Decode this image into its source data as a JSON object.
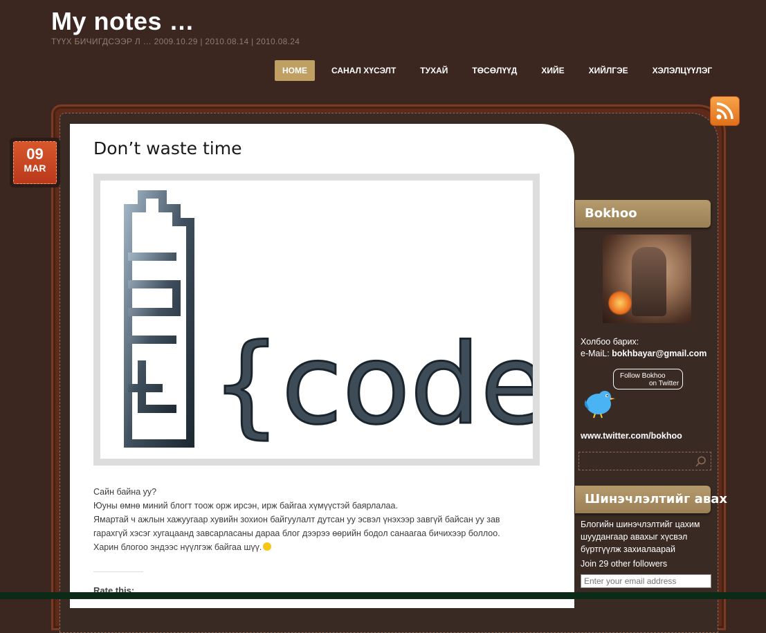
{
  "site": {
    "title": "My notes …",
    "description": "ТҮҮХ БИЧИГДСЭЭР Л … 2009.10.29 | 2010.08.14 | 2010.08.24"
  },
  "nav": {
    "items": [
      {
        "label": "HOME",
        "active": true
      },
      {
        "label": "САНАЛ ХҮСЭЛТ",
        "active": false
      },
      {
        "label": "ТУХАЙ",
        "active": false
      },
      {
        "label": "ТӨСӨЛҮҮД",
        "active": false
      },
      {
        "label": "ХИЙЕ",
        "active": false
      },
      {
        "label": "ХИЙЛГЭЕ",
        "active": false
      },
      {
        "label": "ХЭЛЭЛЦҮҮЛЭГ",
        "active": false
      }
    ]
  },
  "post": {
    "date_day": "09",
    "date_month": "MAR",
    "title": "Don’t waste time",
    "image_text": "{coder}",
    "body": [
      "Сайн байна уу?",
      "Юуны өмнө миний блогт тоож орж ирсэн, ирж байгаа хүмүүстэй баярлалаа.",
      "Ямартай ч ажлын хажуугаар хувийн зохион байгуулалт дутсан уу эсвэл үнэхээр завгүй байсан уу зав гарахгүй хэсэг хугацаанд завсарласаны дараа блог дээрээ өөрийн бодол санаагаа бичихээр боллоо.",
      "Харин блогоо эндээс нүүлгэж байгаа шүү."
    ],
    "rate_label": "Rate this:"
  },
  "sidebar": {
    "profile_title": "Bokhoo",
    "contact_label": "Холбоо барих:",
    "email_prefix": "e-MaiL: ",
    "email": "bokhbayar@gmail.com",
    "follow_line1": "Follow Bokhoo",
    "follow_line2": "on Twitter",
    "twitter_url": "www.twitter.com/bokhoo",
    "subscribe_title": "Шинэчлэлтийг авах",
    "subscribe_text": "Блогийн шинэчлэлтийг цахим шуудангаар авахыг хүсвэл бүртгүүлж захиалаарай",
    "followers": "Join 29 other followers",
    "email_placeholder": "Enter your email address"
  },
  "colors": {
    "background": "#3b2620",
    "accent": "#bf9f62",
    "date_badge": "#c9461f"
  },
  "icons": [
    "rss-icon",
    "search-icon",
    "twitter-bird-icon",
    "smiley-icon"
  ]
}
